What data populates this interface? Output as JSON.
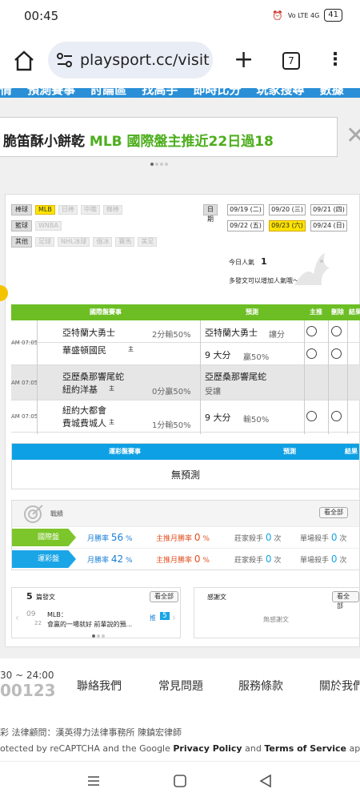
{
  "status": {
    "time": "00:45",
    "battery": "41",
    "signal": "Vo LTE 4G"
  },
  "browser": {
    "url": "playsport.cc/visit",
    "tab_count": "7"
  },
  "nav": {
    "items": [
      "情",
      "預測賽事",
      "討論區",
      "找高手",
      "即時比分",
      "玩家搜尋",
      "數據"
    ]
  },
  "banner": {
    "text_black": "脆笛酥小餅乾",
    "text_green": "MLB 國際盤主推近22日過18"
  },
  "filters": {
    "baseball_label": "棒球",
    "baseball_opts": [
      "MLB",
      "日棒",
      "中職",
      "韓棒"
    ],
    "basketball_label": "籃球",
    "basketball_opts": [
      "WNBA"
    ],
    "other_label": "其他",
    "other_opts": [
      "足球",
      "NHL冰球",
      "俄冰",
      "賽馬",
      "美足"
    ]
  },
  "dates": {
    "label": "日期",
    "items": [
      "09/19 (二)",
      "09/20 (三)",
      "09/21 (四)",
      "09/22 (五)",
      "09/23 (六)",
      "09/24 (日)"
    ],
    "selected": "09/23 (六)"
  },
  "popularity": {
    "label": "今日人氣",
    "count": "1",
    "hint": "多發文可以增加人氣哦～"
  },
  "intl_table": {
    "headers": {
      "match": "國際盤賽事",
      "predict": "預測",
      "main": "主推",
      "delete": "刪除",
      "result": "結果"
    },
    "games": [
      {
        "time": "AM 07:05",
        "away": "亞特蘭大勇士",
        "home": "華盛頓國民",
        "home_tag": "主",
        "line": "2分輸50%",
        "picks": [
          {
            "team": "亞特蘭大勇士",
            "note": "讓分"
          },
          {
            "team": "9 大分",
            "note": "贏50%"
          }
        ]
      },
      {
        "time": "AM 07:05",
        "away": "亞歷桑那響尾蛇",
        "home": "紐約洋基",
        "home_tag": "主",
        "line": "0分贏50%",
        "picks": [
          {
            "team": "亞歷桑那響尾蛇",
            "note": "受讓"
          }
        ]
      },
      {
        "time": "AM 07:05",
        "away": "紐約大都會",
        "home": "費城費城人",
        "home_tag": "主",
        "line": "1分輸50%",
        "picks": [
          {
            "team": "9 大分",
            "note": "輸50%"
          }
        ]
      }
    ]
  },
  "lottery_table": {
    "headers": {
      "match": "運彩盤賽事",
      "predict": "預測",
      "result": "結果"
    },
    "empty": "無預測"
  },
  "stats": {
    "title": "戰績",
    "view_all": "看全部",
    "rows": [
      {
        "tag": "國際盤",
        "color": "#7cc52a",
        "month": "月勝率",
        "month_val": "56",
        "pct": "%",
        "main": "主推月勝率",
        "main_val": "0",
        "pct2": "%",
        "killer": "莊家殺手",
        "killer_val": "0",
        "unit": "次",
        "single": "單場殺手",
        "single_val": "0",
        "unit2": "次"
      },
      {
        "tag": "運彩盤",
        "color": "#1aa5e6",
        "month": "月勝率",
        "month_val": "42",
        "pct": "%",
        "main": "主推月勝率",
        "main_val": "0",
        "pct2": "%",
        "killer": "莊家殺手",
        "killer_val": "0",
        "unit": "次",
        "single": "單場殺手",
        "single_val": "0",
        "unit2": "次"
      }
    ]
  },
  "posts": {
    "count": "5",
    "label": "篇發文",
    "view_all": "看全部",
    "month": "09",
    "day": "22",
    "cat": "MLB：",
    "snippet": "會贏的一場就好 前輩說的預...",
    "push": "推",
    "push_count": "5"
  },
  "thanks": {
    "title": "感謝文",
    "view_all": "看全部",
    "empty": "無感謝文"
  },
  "footer": {
    "hours": "30 ~ 24:00",
    "phone": "00123",
    "links": [
      "聯絡我們",
      "常見問題",
      "服務條款",
      "關於我們"
    ],
    "legal": "彩  法律顧問：漢英得力法律事務所 陳鎮宏律師",
    "captcha_pre": "otected by reCAPTCHA and the Google ",
    "privacy": "Privacy Policy",
    "and": " and ",
    "terms": "Terms of Service",
    "apply": " apply."
  }
}
